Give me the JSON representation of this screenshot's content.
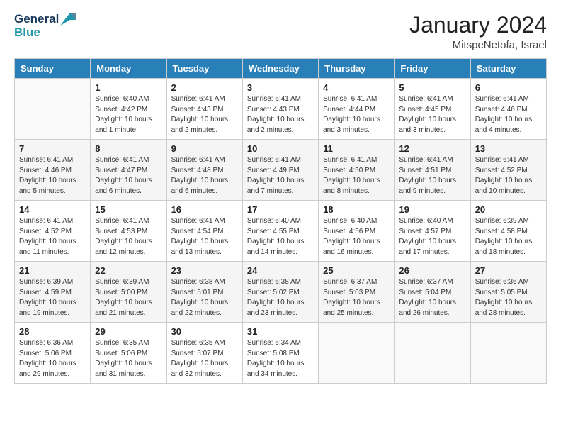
{
  "logo": {
    "line1": "General",
    "line2": "Blue"
  },
  "title": "January 2024",
  "subtitle": "MitspeNetofa, Israel",
  "header_days": [
    "Sunday",
    "Monday",
    "Tuesday",
    "Wednesday",
    "Thursday",
    "Friday",
    "Saturday"
  ],
  "weeks": [
    [
      {
        "day": "",
        "sunrise": "",
        "sunset": "",
        "daylight": ""
      },
      {
        "day": "1",
        "sunrise": "6:40 AM",
        "sunset": "4:42 PM",
        "daylight": "10 hours and 1 minute."
      },
      {
        "day": "2",
        "sunrise": "6:41 AM",
        "sunset": "4:43 PM",
        "daylight": "10 hours and 2 minutes."
      },
      {
        "day": "3",
        "sunrise": "6:41 AM",
        "sunset": "4:43 PM",
        "daylight": "10 hours and 2 minutes."
      },
      {
        "day": "4",
        "sunrise": "6:41 AM",
        "sunset": "4:44 PM",
        "daylight": "10 hours and 3 minutes."
      },
      {
        "day": "5",
        "sunrise": "6:41 AM",
        "sunset": "4:45 PM",
        "daylight": "10 hours and 3 minutes."
      },
      {
        "day": "6",
        "sunrise": "6:41 AM",
        "sunset": "4:46 PM",
        "daylight": "10 hours and 4 minutes."
      }
    ],
    [
      {
        "day": "7",
        "sunrise": "6:41 AM",
        "sunset": "4:46 PM",
        "daylight": "10 hours and 5 minutes."
      },
      {
        "day": "8",
        "sunrise": "6:41 AM",
        "sunset": "4:47 PM",
        "daylight": "10 hours and 6 minutes."
      },
      {
        "day": "9",
        "sunrise": "6:41 AM",
        "sunset": "4:48 PM",
        "daylight": "10 hours and 6 minutes."
      },
      {
        "day": "10",
        "sunrise": "6:41 AM",
        "sunset": "4:49 PM",
        "daylight": "10 hours and 7 minutes."
      },
      {
        "day": "11",
        "sunrise": "6:41 AM",
        "sunset": "4:50 PM",
        "daylight": "10 hours and 8 minutes."
      },
      {
        "day": "12",
        "sunrise": "6:41 AM",
        "sunset": "4:51 PM",
        "daylight": "10 hours and 9 minutes."
      },
      {
        "day": "13",
        "sunrise": "6:41 AM",
        "sunset": "4:52 PM",
        "daylight": "10 hours and 10 minutes."
      }
    ],
    [
      {
        "day": "14",
        "sunrise": "6:41 AM",
        "sunset": "4:52 PM",
        "daylight": "10 hours and 11 minutes."
      },
      {
        "day": "15",
        "sunrise": "6:41 AM",
        "sunset": "4:53 PM",
        "daylight": "10 hours and 12 minutes."
      },
      {
        "day": "16",
        "sunrise": "6:41 AM",
        "sunset": "4:54 PM",
        "daylight": "10 hours and 13 minutes."
      },
      {
        "day": "17",
        "sunrise": "6:40 AM",
        "sunset": "4:55 PM",
        "daylight": "10 hours and 14 minutes."
      },
      {
        "day": "18",
        "sunrise": "6:40 AM",
        "sunset": "4:56 PM",
        "daylight": "10 hours and 16 minutes."
      },
      {
        "day": "19",
        "sunrise": "6:40 AM",
        "sunset": "4:57 PM",
        "daylight": "10 hours and 17 minutes."
      },
      {
        "day": "20",
        "sunrise": "6:39 AM",
        "sunset": "4:58 PM",
        "daylight": "10 hours and 18 minutes."
      }
    ],
    [
      {
        "day": "21",
        "sunrise": "6:39 AM",
        "sunset": "4:59 PM",
        "daylight": "10 hours and 19 minutes."
      },
      {
        "day": "22",
        "sunrise": "6:39 AM",
        "sunset": "5:00 PM",
        "daylight": "10 hours and 21 minutes."
      },
      {
        "day": "23",
        "sunrise": "6:38 AM",
        "sunset": "5:01 PM",
        "daylight": "10 hours and 22 minutes."
      },
      {
        "day": "24",
        "sunrise": "6:38 AM",
        "sunset": "5:02 PM",
        "daylight": "10 hours and 23 minutes."
      },
      {
        "day": "25",
        "sunrise": "6:37 AM",
        "sunset": "5:03 PM",
        "daylight": "10 hours and 25 minutes."
      },
      {
        "day": "26",
        "sunrise": "6:37 AM",
        "sunset": "5:04 PM",
        "daylight": "10 hours and 26 minutes."
      },
      {
        "day": "27",
        "sunrise": "6:36 AM",
        "sunset": "5:05 PM",
        "daylight": "10 hours and 28 minutes."
      }
    ],
    [
      {
        "day": "28",
        "sunrise": "6:36 AM",
        "sunset": "5:06 PM",
        "daylight": "10 hours and 29 minutes."
      },
      {
        "day": "29",
        "sunrise": "6:35 AM",
        "sunset": "5:06 PM",
        "daylight": "10 hours and 31 minutes."
      },
      {
        "day": "30",
        "sunrise": "6:35 AM",
        "sunset": "5:07 PM",
        "daylight": "10 hours and 32 minutes."
      },
      {
        "day": "31",
        "sunrise": "6:34 AM",
        "sunset": "5:08 PM",
        "daylight": "10 hours and 34 minutes."
      },
      {
        "day": "",
        "sunrise": "",
        "sunset": "",
        "daylight": ""
      },
      {
        "day": "",
        "sunrise": "",
        "sunset": "",
        "daylight": ""
      },
      {
        "day": "",
        "sunrise": "",
        "sunset": "",
        "daylight": ""
      }
    ]
  ]
}
